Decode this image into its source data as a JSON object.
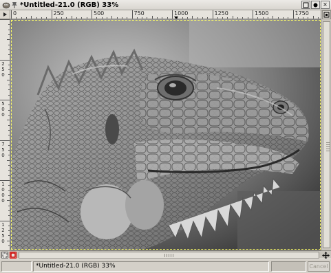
{
  "window": {
    "title": "*Untitled-21.0 (RGB) 33%",
    "buttons": {
      "close_glyph": "×",
      "minimize_glyph": "–"
    }
  },
  "ruler_h": {
    "labels": [
      "|0",
      "|250",
      "|500",
      "|750",
      "|1000",
      "|1250",
      "|1500",
      "|1750"
    ]
  },
  "ruler_v": {
    "labels": [
      "250",
      "500",
      "750",
      "1000",
      "1250"
    ]
  },
  "statusbar": {
    "message": "*Untitled-21.0 (RGB) 33%",
    "cancel_label": "Cancel"
  },
  "icons": {
    "menu": "triangle-right-icon",
    "nav": "move-cross-icon",
    "quickmask": "quick-mask-icon",
    "zoom": "zoom-to-window-icon"
  },
  "colors": {
    "selection": "#ffff66",
    "canvas_bg": "#3e3e3e",
    "quickmask_red": "#cc0000"
  }
}
